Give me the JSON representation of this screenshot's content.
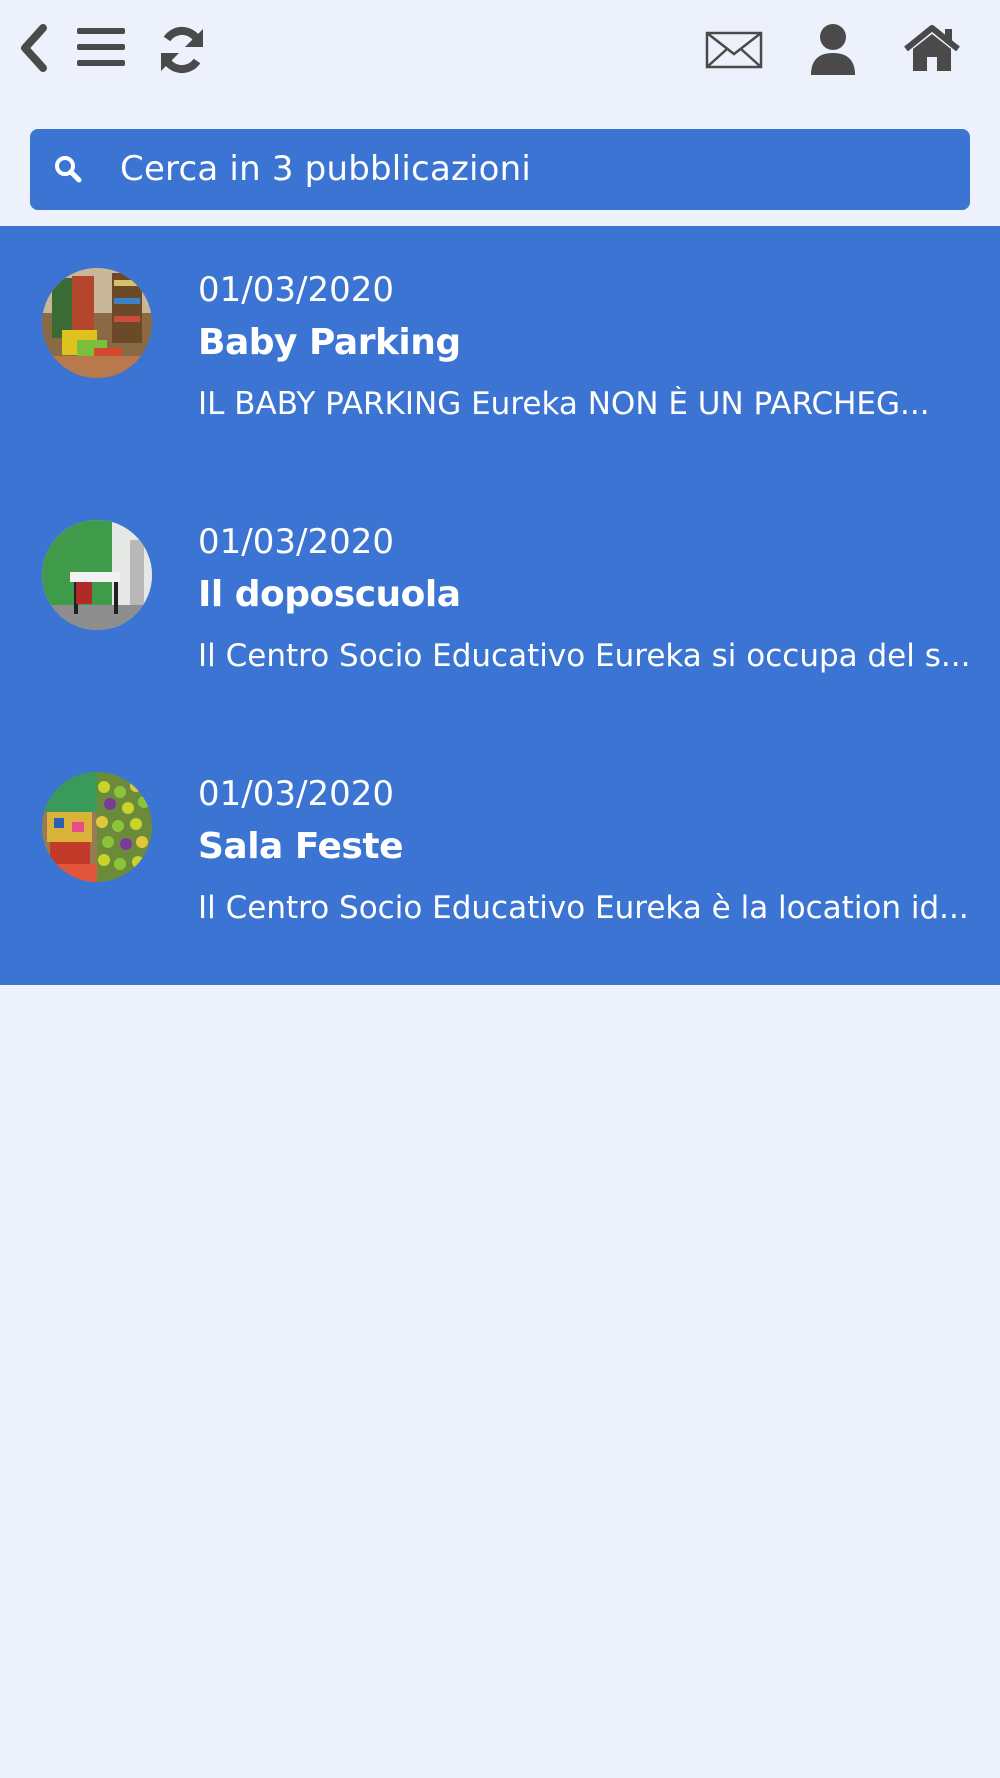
{
  "toolbar": {
    "icons": [
      "back-icon",
      "menu-icon",
      "refresh-icon",
      "mail-icon",
      "user-icon",
      "home-icon"
    ],
    "icon_color": "#4a4a4a"
  },
  "search": {
    "placeholder": "Cerca in 3 pubblicazioni",
    "icon": "search-icon"
  },
  "colors": {
    "background": "#edf1fb",
    "accent": "#3b74d3",
    "text_on_accent": "#ffffff"
  },
  "items": [
    {
      "date": "01/03/2020",
      "title": "Baby Parking",
      "description": "IL BABY PARKING Eureka NON È UN PARCHEG..."
    },
    {
      "date": "01/03/2020",
      "title": "Il doposcuola",
      "description": "Il Centro Socio Educativo Eureka si occupa del s..."
    },
    {
      "date": "01/03/2020",
      "title": "Sala Feste",
      "description": "Il Centro Socio Educativo Eureka è la location id..."
    }
  ]
}
